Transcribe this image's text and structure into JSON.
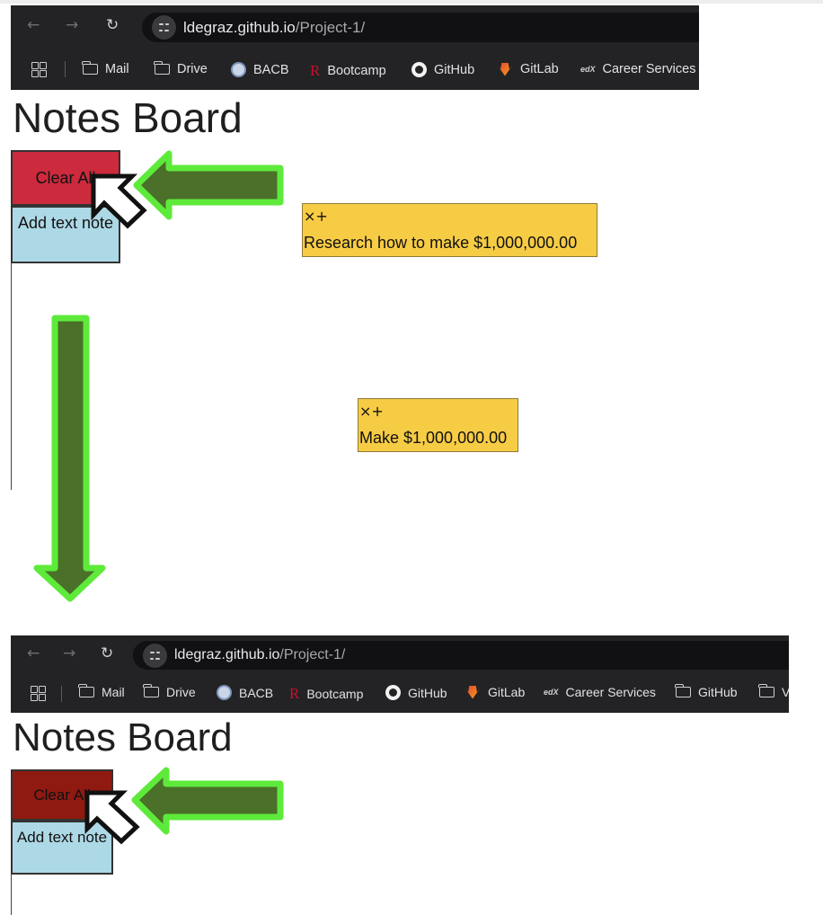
{
  "browser": {
    "url_host": "ldegraz.github.io",
    "url_path": "/Project-1/",
    "bookmarks_top": [
      {
        "label": "Mail",
        "icon": "folder-icon"
      },
      {
        "label": "Drive",
        "icon": "folder-icon"
      },
      {
        "label": "BACB",
        "icon": "bacb-logo-icon"
      },
      {
        "label": "Bootcamp",
        "icon": "rutgers-r-icon"
      },
      {
        "label": "GitHub",
        "icon": "github-icon"
      },
      {
        "label": "GitLab",
        "icon": "gitlab-icon"
      },
      {
        "label": "Career Services",
        "icon": "edx-icon"
      }
    ],
    "bookmarks_bottom": [
      {
        "label": "Mail",
        "icon": "folder-icon"
      },
      {
        "label": "Drive",
        "icon": "folder-icon"
      },
      {
        "label": "BACB",
        "icon": "bacb-logo-icon"
      },
      {
        "label": "Bootcamp",
        "icon": "rutgers-r-icon"
      },
      {
        "label": "GitHub",
        "icon": "github-icon"
      },
      {
        "label": "GitLab",
        "icon": "gitlab-icon"
      },
      {
        "label": "Career Services",
        "icon": "edx-icon"
      },
      {
        "label": "GitHub",
        "icon": "folder-icon"
      },
      {
        "label": "V",
        "icon": "folder-icon"
      }
    ]
  },
  "app": {
    "title": "Notes Board",
    "clear_all_label": "Clear All",
    "add_text_note_label": "Add text note",
    "note_controls": "×+"
  },
  "notes": [
    {
      "text": "Research how to make $1,000,000.00"
    },
    {
      "text": "Make $1,000,000.00"
    }
  ],
  "colors": {
    "clear_all_normal": "#cc2a3d",
    "clear_all_pressed": "#8e1a12",
    "add_note": "#add8e6",
    "note_bg": "#f7cc45",
    "arrow_fill": "#4a7029",
    "arrow_stroke": "#5eea3a"
  }
}
